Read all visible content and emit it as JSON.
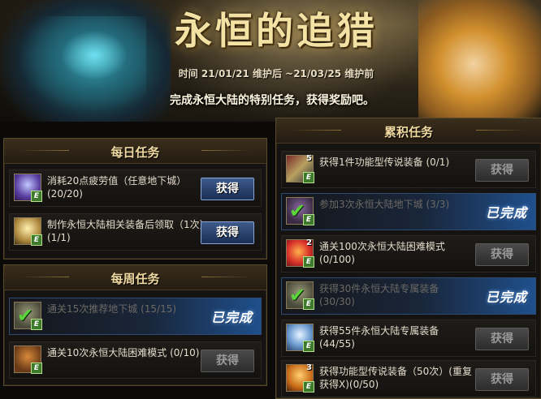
{
  "banner": {
    "title": "永恒的追猎",
    "period": "时间 21/01/21 维护后 ~21/03/25 维护前",
    "subtitle": "完成永恒大陆的特别任务，获得奖励吧。"
  },
  "daily": {
    "header": "每日任务",
    "tasks": [
      {
        "text": "消耗20点疲劳值（任意地下城）(20/20)",
        "button": "获得",
        "state": "active",
        "icon": "fatigue-potion-icon"
      },
      {
        "text": "制作永恒大陆相关装备后领取（1次）(1/1)",
        "button": "获得",
        "state": "active",
        "icon": "crafting-box-icon"
      }
    ]
  },
  "weekly": {
    "header": "每周任务",
    "tasks": [
      {
        "text": "通关15次推荐地下城 (15/15)",
        "status": "已完成",
        "state": "done",
        "icon": "dungeon-check-icon"
      },
      {
        "text": "通关10次永恒大陆困难模式 (0/10)",
        "button": "获得",
        "state": "disabled",
        "icon": "bottle-icon"
      }
    ]
  },
  "cumulative": {
    "header": "累积任务",
    "tasks": [
      {
        "text": "获得1件功能型传说装备 (0/1)",
        "button": "获得",
        "state": "disabled",
        "icon": "legendary-set-icon",
        "badge": "5"
      },
      {
        "text": "参加3次永恒大陆地下城 (3/3)",
        "status": "已完成",
        "state": "done",
        "icon": "dungeon-check-icon"
      },
      {
        "text": "通关100次永恒大陆困难模式 (0/100)",
        "button": "获得",
        "state": "disabled",
        "icon": "fire-cube-icon",
        "badge": "2"
      },
      {
        "text": "获得30件永恒大陆专属装备 (30/30)",
        "status": "已完成",
        "state": "done",
        "icon": "equipment-check-icon"
      },
      {
        "text": "获得55件永恒大陆专属装备 (44/55)",
        "button": "获得",
        "state": "disabled",
        "icon": "scroll-icon"
      },
      {
        "text": "获得功能型传说装备（50次）(重复获得X)(0/50)",
        "button": "获得",
        "state": "disabled",
        "icon": "legendary-gear-icon",
        "badge": "3"
      }
    ]
  },
  "colors": {
    "active_button": "#2a4578",
    "done_gradient": "#1f4f8c",
    "header_text": "#f0d9a0"
  }
}
